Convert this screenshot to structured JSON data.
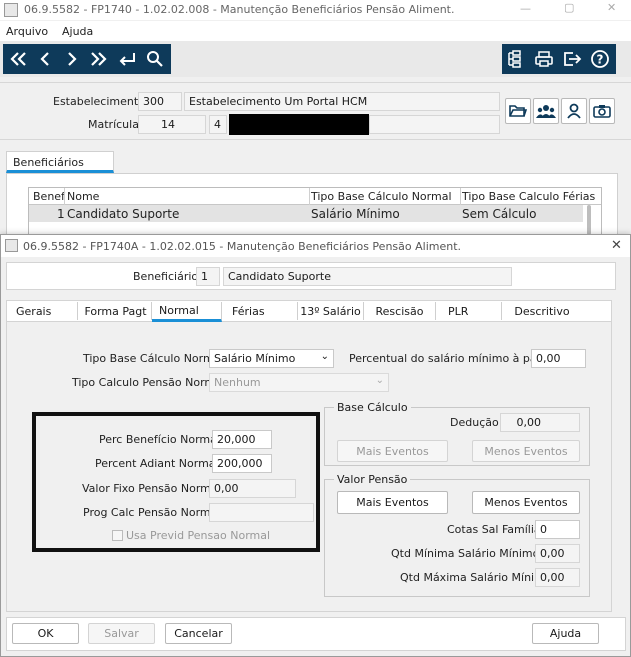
{
  "main_window": {
    "title": "06.9.5582 - FP1740 - 1.02.02.008 - Manutenção Beneficiários Pensão Aliment.",
    "menu": [
      "Arquivo",
      "Ajuda"
    ],
    "estabelecimento_label": "Estabelecimento:",
    "estabelecimento_code": "300",
    "estabelecimento_name": "Estabelecimento Um Portal HCM",
    "matricula_label": "Matrícula:",
    "matricula_value": "14",
    "matricula_digit": "4",
    "tab_label": "Beneficiários",
    "grid_headers": [
      "Benef",
      "Nome",
      "Tipo Base Cálculo Normal",
      "Tipo Base Calculo Férias"
    ],
    "grid_row": [
      "1",
      "Candidato Suporte",
      "Salário Mínimo",
      "Sem Cálculo"
    ]
  },
  "dialog": {
    "title": "06.9.5582 - FP1740A - 1.02.02.015 - Manutenção Beneficiários Pensão Aliment.",
    "beneficiario_label": "Beneficiário:",
    "beneficiario_code": "1",
    "beneficiario_name": "Candidato Suporte",
    "tabs": [
      "Gerais",
      "Forma Pagt",
      "Normal",
      "Férias",
      "13º Salário",
      "Rescisão",
      "PLR",
      "Descritivo"
    ],
    "tipo_base_label": "Tipo Base Cálculo Normal:",
    "tipo_base_value": "Salário Mínimo",
    "percentual_label": "Percentual do salário mínimo à pagar:",
    "percentual_value": "0,00",
    "tipo_calculo_label": "Tipo Calculo Pensão Normal:",
    "tipo_calculo_value": "Nenhum",
    "perc_beneficio_label": "Perc Benefício Normal:",
    "perc_beneficio_value": "20,000",
    "percent_adiant_label": "Percent Adiant Normal:",
    "percent_adiant_value": "200,000",
    "valor_fixo_label": "Valor Fixo Pensão Normal:",
    "valor_fixo_value": "0,00",
    "prog_calc_label": "Prog Calc Pensão Normal:",
    "prog_calc_value": "",
    "usa_previd_label": "Usa Previd Pensao Normal",
    "base_calculo_title": "Base Cálculo",
    "deducao_label": "Dedução:",
    "deducao_value": "0,00",
    "mais_eventos": "Mais Eventos",
    "menos_eventos": "Menos Eventos",
    "valor_pensao_title": "Valor Pensão",
    "cotas_label": "Cotas Sal Família:",
    "cotas_value": "0",
    "qtd_min_label": "Qtd Mínima Salário Mínimo:",
    "qtd_min_value": "0,00",
    "qtd_max_label": "Qtd Máxima Salário Mínimo:",
    "qtd_max_value": "0,00",
    "ok": "OK",
    "salvar": "Salvar",
    "cancelar": "Cancelar",
    "ajuda": "Ajuda"
  },
  "colors": {
    "toolbar": "#0e3a5a",
    "accent": "#1a8fd6",
    "highlight_box": "#111111"
  },
  "icons": [
    "first-page-icon",
    "prev-icon",
    "next-icon",
    "last-page-icon",
    "return-icon",
    "search-icon",
    "tree-icon",
    "print-icon",
    "exit-icon",
    "help-icon",
    "folder-icon",
    "users-icon",
    "user-icon",
    "camera-icon",
    "close-icon",
    "chevron-down-icon"
  ]
}
